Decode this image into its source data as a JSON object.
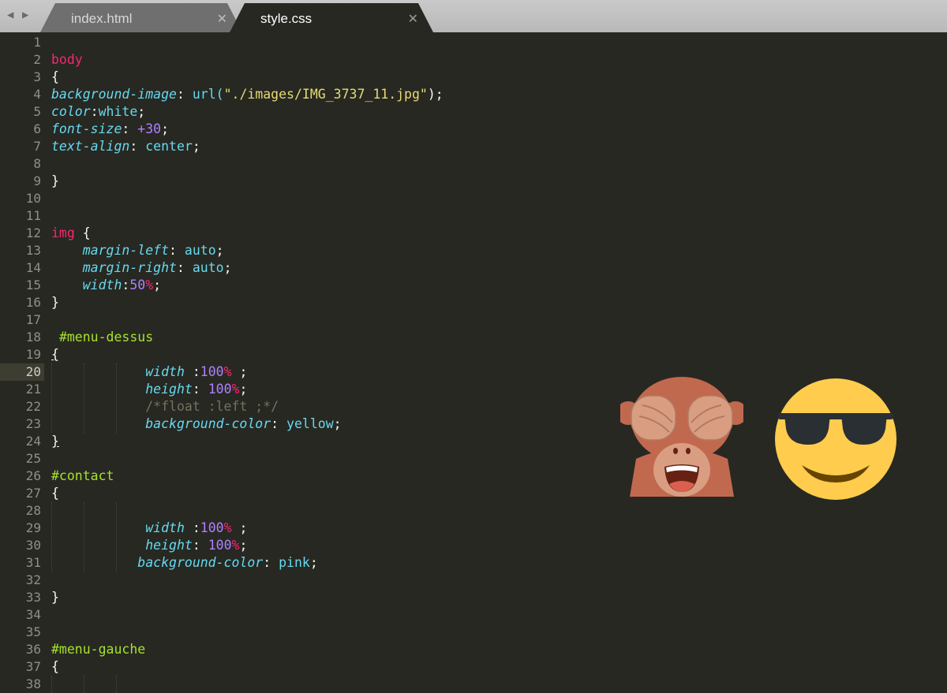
{
  "tabs": [
    {
      "label": "index.html",
      "active": false
    },
    {
      "label": "style.css",
      "active": true
    }
  ],
  "current_line": 20,
  "code": {
    "l4_prop": "background-image",
    "l4_func": "url(",
    "l4_str": "\"./images/IMG_3737_11.jpg\"",
    "l4_end": ");",
    "l5_prop": "color",
    "l5_val": "white",
    "l6_prop": "font-size",
    "l6_num": "+30",
    "l7_prop": "text-align",
    "l7_val": "center",
    "l12_sel": "img",
    "l13_prop": "margin-left",
    "l13_val": "auto",
    "l14_prop": "margin-right",
    "l14_val": "auto",
    "l15_prop": "width",
    "l15_num": "50",
    "l18_sel": "#menu-dessus",
    "l20_prop": "width",
    "l20_num": "100",
    "l21_prop": "height",
    "l21_num": "100",
    "l22_cmt": "/*float :left ;*/",
    "l23_prop": "background-color",
    "l23_val": "yellow",
    "l26_sel": "#contact",
    "l29_prop": "width",
    "l29_num": "100",
    "l30_prop": "height",
    "l30_num": "100",
    "l31_prop": "background-color",
    "l31_val": "pink",
    "l36_sel": "#menu-gauche",
    "body_sel": "body"
  },
  "emoji": [
    "see-no-evil-monkey",
    "smiling-face-with-sunglasses"
  ],
  "colors": {
    "background": "#272822",
    "selector": "#f92672",
    "id_selector": "#a6e22e",
    "property": "#66d9ef",
    "number": "#ae81ff",
    "string": "#e6db74",
    "comment": "#75715e"
  }
}
